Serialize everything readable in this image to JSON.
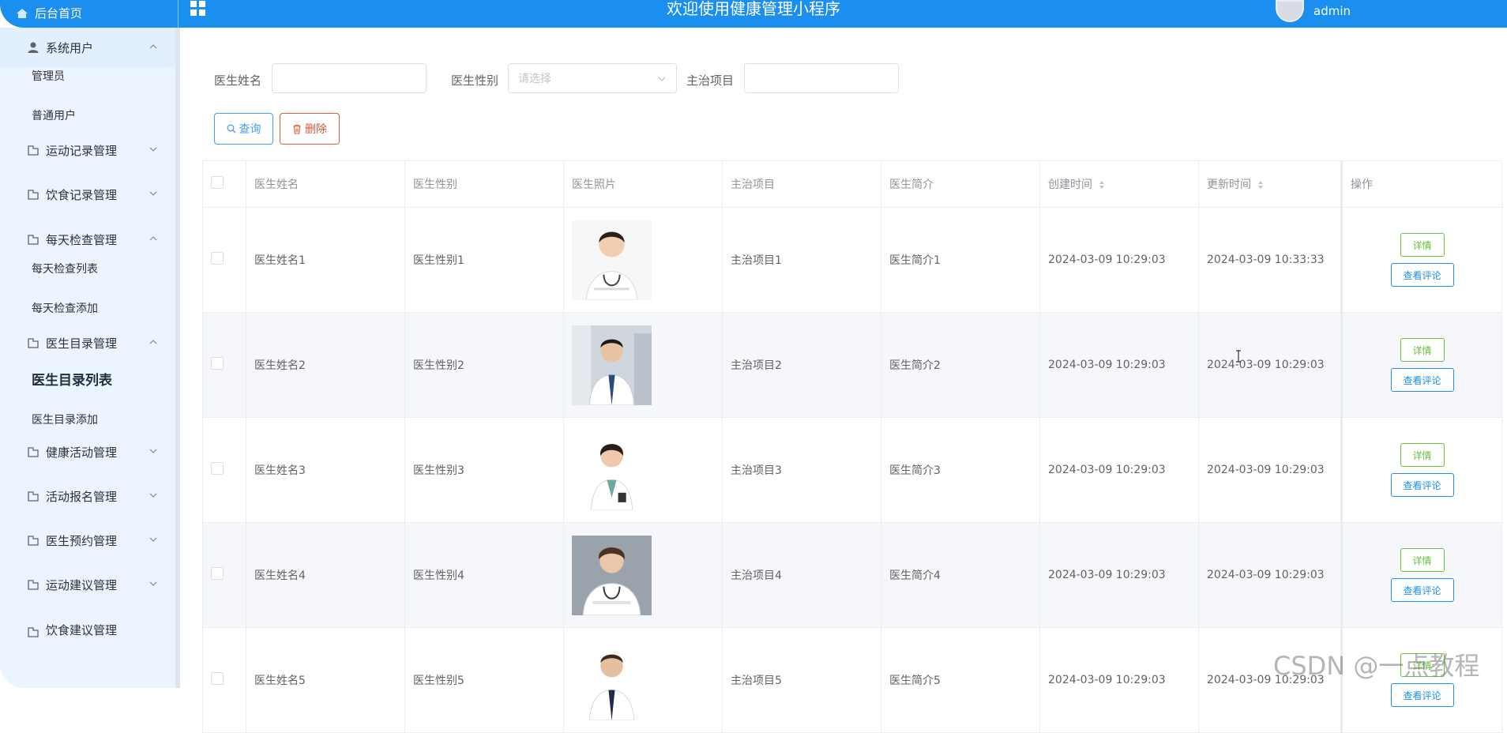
{
  "header": {
    "home_label": "后台首页",
    "title": "欢迎使用健康管理小程序",
    "username": "admin",
    "bg_color": "#1a8ff0"
  },
  "sidebar": {
    "items": [
      {
        "label": "系统用户",
        "icon": "user-icon",
        "expanded": true
      },
      {
        "label": "管理员",
        "sub": true
      },
      {
        "label": "普通用户",
        "sub": true
      },
      {
        "label": "运动记录管理",
        "icon": "folder-icon",
        "expanded": false
      },
      {
        "label": "饮食记录管理",
        "icon": "folder-icon",
        "expanded": false
      },
      {
        "label": "每天检查管理",
        "icon": "folder-icon",
        "expanded": true
      },
      {
        "label": "每天检查列表",
        "sub": true
      },
      {
        "label": "每天检查添加",
        "sub": true
      },
      {
        "label": "医生目录管理",
        "icon": "folder-icon",
        "expanded": true
      },
      {
        "label": "医生目录列表",
        "sub": true,
        "current": true
      },
      {
        "label": "医生目录添加",
        "sub": true
      },
      {
        "label": "健康活动管理",
        "icon": "folder-icon",
        "expanded": false
      },
      {
        "label": "活动报名管理",
        "icon": "folder-icon",
        "expanded": false
      },
      {
        "label": "医生预约管理",
        "icon": "folder-icon",
        "expanded": false
      },
      {
        "label": "运动建议管理",
        "icon": "folder-icon",
        "expanded": false
      },
      {
        "label": "饮食建议管理",
        "icon": "folder-icon",
        "expanded": false
      }
    ]
  },
  "filters": {
    "name_label": "医生姓名",
    "name_value": "",
    "gender_label": "医生性别",
    "gender_placeholder": "请选择",
    "project_label": "主治项目",
    "project_value": ""
  },
  "buttons": {
    "query": "查询",
    "delete": "删除"
  },
  "table": {
    "columns": [
      "医生姓名",
      "医生性别",
      "医生照片",
      "主治项目",
      "医生简介",
      "创建时间",
      "更新时间",
      "操作"
    ],
    "detail_label": "详情",
    "comment_label": "查看评论",
    "rows": [
      {
        "name": "医生姓名1",
        "gender": "医生性别1",
        "project": "主治项目1",
        "intro": "医生简介1",
        "created": "2024-03-09 10:29:03",
        "updated": "2024-03-09 10:33:33"
      },
      {
        "name": "医生姓名2",
        "gender": "医生性别2",
        "project": "主治项目2",
        "intro": "医生简介2",
        "created": "2024-03-09 10:29:03",
        "updated": "2024-03-09 10:29:03"
      },
      {
        "name": "医生姓名3",
        "gender": "医生性别3",
        "project": "主治项目3",
        "intro": "医生简介3",
        "created": "2024-03-09 10:29:03",
        "updated": "2024-03-09 10:29:03"
      },
      {
        "name": "医生姓名4",
        "gender": "医生性别4",
        "project": "主治项目4",
        "intro": "医生简介4",
        "created": "2024-03-09 10:29:03",
        "updated": "2024-03-09 10:29:03"
      },
      {
        "name": "医生姓名5",
        "gender": "医生性别5",
        "project": "主治项目5",
        "intro": "医生简介5",
        "created": "2024-03-09 10:29:03",
        "updated": "2024-03-09 10:29:03"
      }
    ]
  },
  "watermark": "CSDN @一点教程"
}
